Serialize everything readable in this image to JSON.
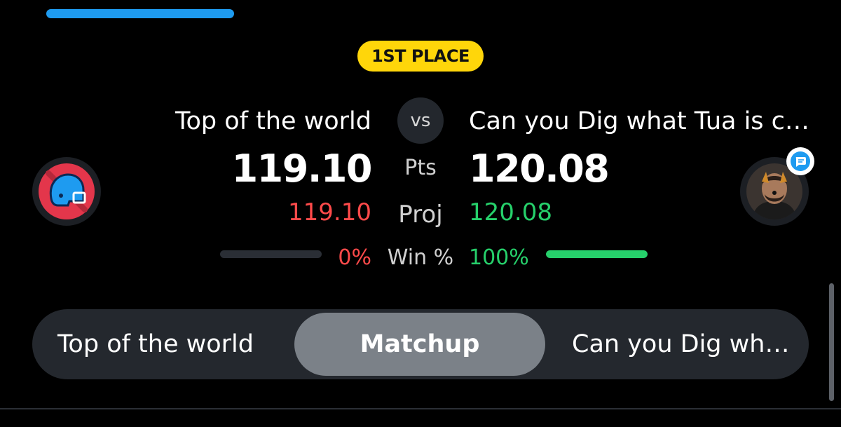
{
  "header": {
    "progress": 0.25,
    "badge": "1ST PLACE"
  },
  "matchup": {
    "left": {
      "name": "Top of the world",
      "score": "119.10",
      "proj": "119.10",
      "win_pct": "0%",
      "win_fraction": 0.0
    },
    "right": {
      "name": "Can you Dig what Tua is c…",
      "score": "120.08",
      "proj": "120.08",
      "win_pct": "100%",
      "win_fraction": 1.0
    },
    "labels": {
      "vs": "vs",
      "pts": "Pts",
      "proj": "Proj",
      "win": "Win %"
    }
  },
  "tabs": {
    "left": "Top of the world",
    "center": "Matchup",
    "right": "Can you Dig wh…"
  },
  "colors": {
    "accent_blue": "#1e9bf0",
    "badge_yellow": "#ffd60a",
    "loss_red": "#ff4a4a",
    "win_green": "#26d06b"
  },
  "icons": {
    "left_avatar": "football-helmet-icon",
    "right_avatar": "user-photo-avatar",
    "chat": "chat-bubble-icon"
  }
}
